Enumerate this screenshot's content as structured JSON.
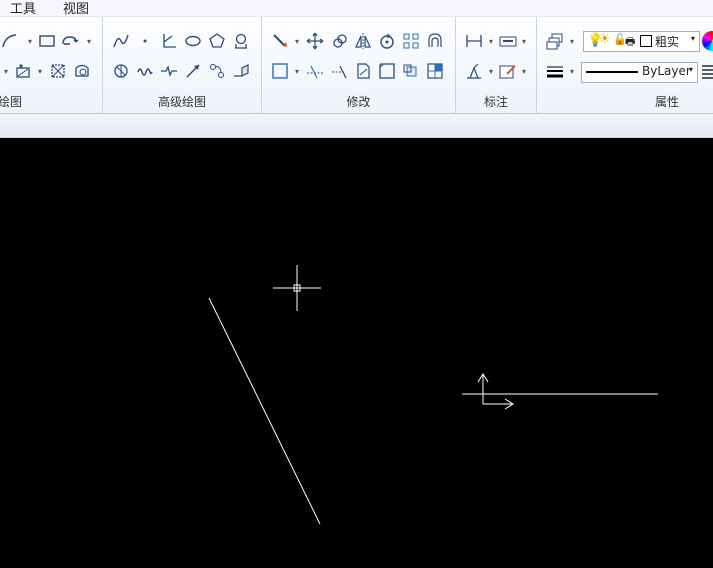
{
  "menubar": {
    "items": [
      "工具",
      "视图"
    ]
  },
  "ribbon": {
    "panels": {
      "draw": {
        "title": "绘图"
      },
      "advanced_draw": {
        "title": "高级绘图"
      },
      "modify": {
        "title": "修改"
      },
      "annotate": {
        "title": "标注"
      },
      "properties": {
        "title": "属性"
      }
    },
    "layer_combo": {
      "value": "粗实"
    },
    "linetype_combo": {
      "value": "ByLayer"
    }
  },
  "canvas": {
    "background": "#000000",
    "stroke_color": "#ffffff"
  }
}
